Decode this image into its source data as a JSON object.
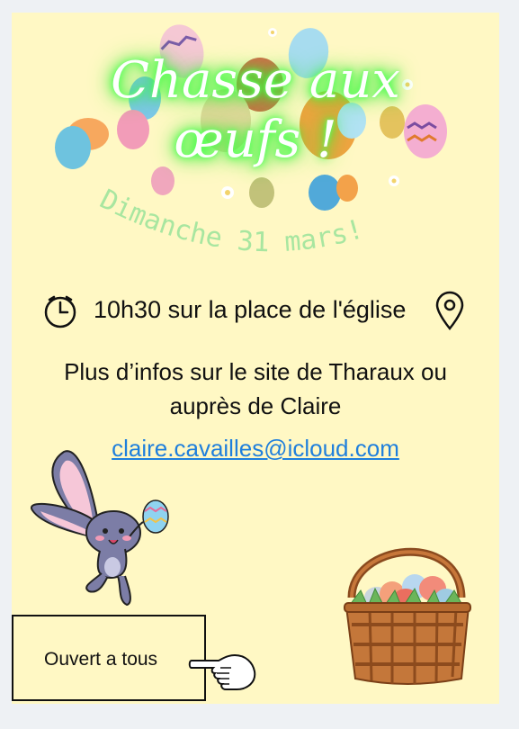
{
  "poster": {
    "title_line1": "Chasse aux",
    "title_line2": "œufs !",
    "date_text": "Dimanche 31 mars!",
    "time_place": "10h30 sur la place de l'église",
    "info_line1": "Plus d’infos sur le site de Tharaux ou",
    "info_line2": "auprès de Claire",
    "email": "claire.cavailles@icloud.com",
    "open_label": "Ouvert a tous"
  },
  "colors": {
    "background": "#fff8c4",
    "title_glow": "#2bff2b",
    "date_text": "#a8e6a0",
    "link": "#1f7fdc"
  },
  "icons": [
    "clock-icon",
    "location-pin-icon",
    "pointing-hand-icon",
    "bunny-illustration",
    "easter-basket-illustration",
    "easter-eggs-illustration"
  ]
}
